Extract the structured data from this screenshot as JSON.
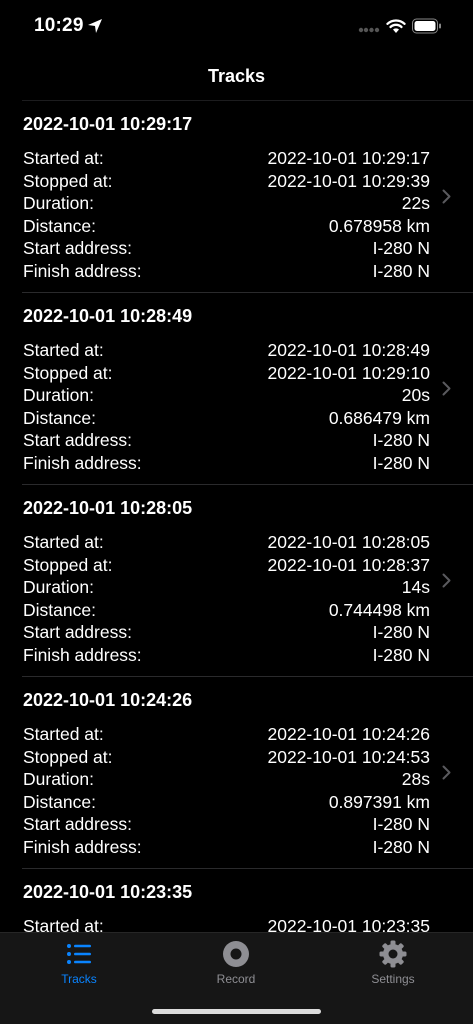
{
  "status_bar": {
    "time": "10:29"
  },
  "nav": {
    "title": "Tracks"
  },
  "labels": {
    "started": "Started at:",
    "stopped": "Stopped at:",
    "duration": "Duration:",
    "distance": "Distance:",
    "start_address": "Start address:",
    "finish_address": "Finish address:"
  },
  "tracks": [
    {
      "title": "2022-10-01 10:29:17",
      "started": "2022-10-01 10:29:17",
      "stopped": "2022-10-01 10:29:39",
      "duration": "22s",
      "distance": "0.678958 km",
      "start_address": "I-280 N",
      "finish_address": "I-280 N"
    },
    {
      "title": "2022-10-01 10:28:49",
      "started": "2022-10-01 10:28:49",
      "stopped": "2022-10-01 10:29:10",
      "duration": "20s",
      "distance": "0.686479 km",
      "start_address": "I-280 N",
      "finish_address": "I-280 N"
    },
    {
      "title": "2022-10-01 10:28:05",
      "started": "2022-10-01 10:28:05",
      "stopped": "2022-10-01 10:28:37",
      "duration": "14s",
      "distance": "0.744498 km",
      "start_address": "I-280 N",
      "finish_address": "I-280 N"
    },
    {
      "title": "2022-10-01 10:24:26",
      "started": "2022-10-01 10:24:26",
      "stopped": "2022-10-01 10:24:53",
      "duration": "28s",
      "distance": "0.897391 km",
      "start_address": "I-280 N",
      "finish_address": "I-280 N"
    },
    {
      "title": "2022-10-01 10:23:35",
      "started": "2022-10-01 10:23:35"
    }
  ],
  "tabbar": {
    "tracks": {
      "label": "Tracks",
      "icon": "list-icon"
    },
    "record": {
      "label": "Record",
      "icon": "record-icon"
    },
    "settings": {
      "label": "Settings",
      "icon": "gear-icon"
    }
  },
  "colors": {
    "accent": "#0a84ff",
    "inactive": "#8e8e93",
    "background": "#000000"
  }
}
